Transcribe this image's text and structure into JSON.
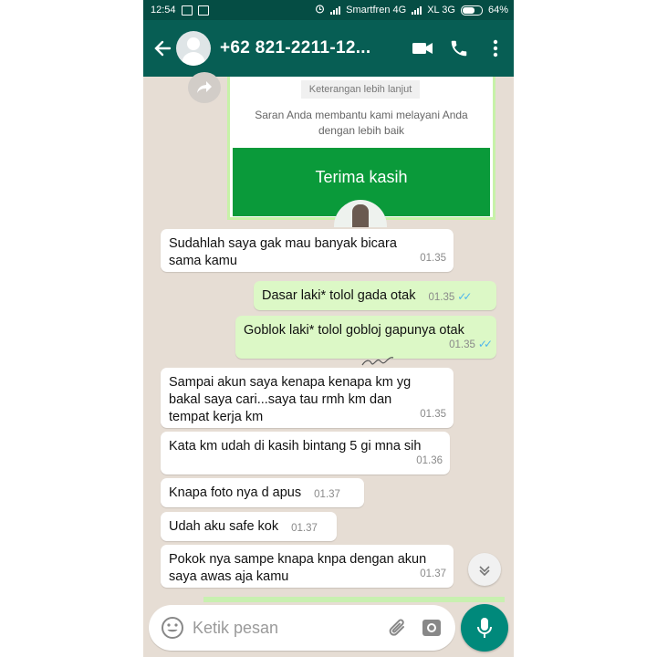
{
  "status_bar": {
    "time": "12:54",
    "carrier1": "Smartfren 4G",
    "carrier2": "XL 3G",
    "battery": "64%"
  },
  "app_bar": {
    "contact_name": "+62 821-2211-12..."
  },
  "forwarded_card": {
    "more_info": "Keterangan lebih lanjut",
    "note": "Saran Anda membantu kami melayani Anda\ndengan lebih baik",
    "thanks": "Terima kasih"
  },
  "messages": [
    {
      "dir": "in",
      "text": "Sudahlah saya gak mau banyak bicara\nsama kamu",
      "time": "01.35"
    },
    {
      "dir": "out",
      "text": "Dasar laki* tolol gada otak",
      "time": "01.35",
      "ticks": "✓✓"
    },
    {
      "dir": "out",
      "text": "Goblok laki* tolol gobloj gapunya otak",
      "time": "01.35",
      "ticks": "✓✓"
    },
    {
      "dir": "in",
      "text": "Sampai akun saya kenapa kenapa km yg\nbakal saya cari...saya tau rmh km dan\ntempat kerja km",
      "time": "01.35"
    },
    {
      "dir": "in",
      "text": "Kata km udah di kasih bintang 5 gi mna sih",
      "time": "01.36"
    },
    {
      "dir": "in",
      "text": "Knapa foto nya d apus",
      "time": "01.37"
    },
    {
      "dir": "in",
      "text": "Udah aku safe kok",
      "time": "01.37"
    },
    {
      "dir": "in",
      "text": "Pokok nya sampe knapa knpa dengan akun\nsaya awas aja kamu",
      "time": "01.37"
    }
  ],
  "composer": {
    "placeholder": "Ketik pesan"
  },
  "colors": {
    "header": "#075e54",
    "status_bar": "#054d44",
    "outgoing_bubble": "#dcf8c6",
    "chat_background": "#e6ddd4",
    "mic_button": "#00897b",
    "read_ticks": "#4fb6ec"
  },
  "icons": [
    "back-arrow-icon",
    "video-call-icon",
    "phone-call-icon",
    "more-vert-icon",
    "forward-icon",
    "chevron-down-icon",
    "emoji-icon",
    "attach-icon",
    "camera-icon",
    "mic-icon"
  ]
}
